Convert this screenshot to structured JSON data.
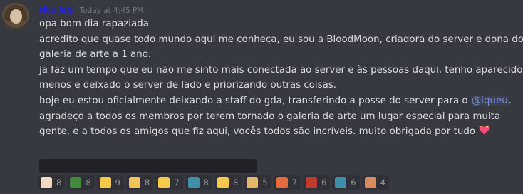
{
  "message": {
    "author": "rita lee",
    "timestamp": "Today at 4:45 PM",
    "lines": [
      "opa bom dia rapaziada",
      "acredito que quase todo mundo aqui me conheça, eu sou a BloodMoon, criadora do server e dona do",
      "galeria de arte a 1 ano.",
      "ja faz um tempo que eu não me sinto mais conectada ao server e às pessoas daqui, tenho aparecido",
      "menos e deixado o server de lado e priorizando outras coisas.",
      "agradeço a todos os membros por terem tornado o galeria de arte um lugar especial para muita",
      "gente, e a todos os amigos que fiz aqui, vocês todos são incríveis. muito obrigada por tudo"
    ],
    "line5_before_mention": "hoje eu estou oficialmente deixando a staff do gda, transferindo a posse do server para o ",
    "mention": "@iqueu",
    "line5_after_mention": "."
  },
  "reactions": [
    {
      "icon": "hand-icon",
      "count": "8",
      "color": "#f1d9c2"
    },
    {
      "icon": "frog-icon",
      "count": "8",
      "color": "#3f8a3a"
    },
    {
      "icon": "crying-face-icon",
      "count": "9",
      "color": "#f7c948"
    },
    {
      "icon": "fist-icon",
      "count": "8",
      "color": "#f3c45a"
    },
    {
      "icon": "disappointed-face-icon",
      "count": "7",
      "color": "#f7c948"
    },
    {
      "icon": "wave-icon",
      "count": "8",
      "color": "#3f8fa8"
    },
    {
      "icon": "sunglasses-face-icon",
      "count": "8",
      "color": "#f7c948"
    },
    {
      "icon": "dog-icon",
      "count": "5",
      "color": "#e6b86a"
    },
    {
      "icon": "angry-face-icon",
      "count": "7",
      "color": "#e56b3c"
    },
    {
      "icon": "crewmate-icon",
      "count": "6",
      "color": "#c0392b"
    },
    {
      "icon": "wave-icon",
      "count": "6",
      "color": "#3f8fa8"
    },
    {
      "icon": "people-icon",
      "count": "4",
      "color": "#d98b5f"
    }
  ]
}
